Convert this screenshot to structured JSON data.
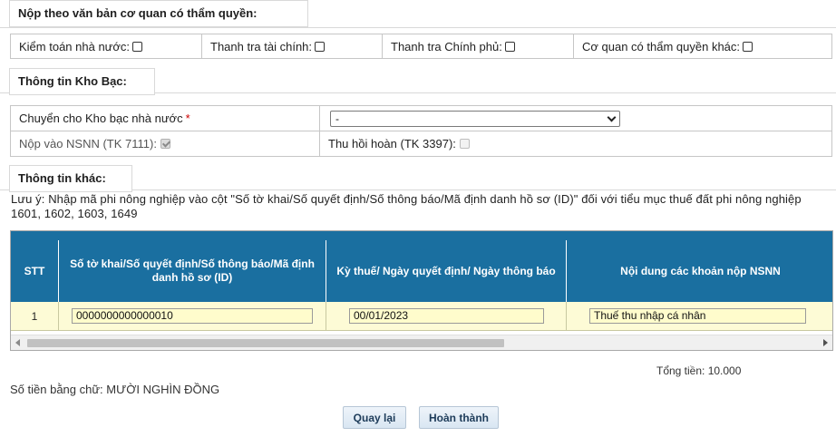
{
  "authority": {
    "header": "Nộp theo văn bản cơ quan có thẩm quyền:",
    "options": [
      {
        "label": "Kiểm toán nhà nước:",
        "checked": false
      },
      {
        "label": "Thanh tra tài chính:",
        "checked": false
      },
      {
        "label": "Thanh tra Chính phủ:",
        "checked": false
      },
      {
        "label": "Cơ quan có thẩm quyền khác:",
        "checked": false
      }
    ]
  },
  "treasury": {
    "header": "Thông tin Kho Bạc:",
    "transfer_label": "Chuyển cho Kho bạc nhà nước",
    "required_mark": "*",
    "transfer_value": "-",
    "nsnn_label": "Nộp vào NSNN (TK 7111):",
    "nsnn_checked": true,
    "refund_label": "Thu hồi hoàn (TK 3397):",
    "refund_checked": false
  },
  "other": {
    "header": "Thông tin khác:",
    "note": "Lưu ý: Nhập mã phi nông nghiệp vào cột \"Số tờ khai/Số quyết định/Số thông báo/Mã định danh hồ sơ (ID)\" đối với tiểu mục thuế đất phi nông nghiệp 1601, 1602, 1603, 1649"
  },
  "table": {
    "columns": [
      "STT",
      "Số tờ khai/Số quyết định/Số thông báo/Mã định danh hồ sơ (ID)",
      "Kỳ thuế/ Ngày quyết định/ Ngày thông báo",
      "Nội dung các khoản nộp NSNN"
    ],
    "rows": [
      {
        "stt": "1",
        "doc_id": "0000000000000010",
        "date": "00/01/2023",
        "content": "Thuế thu nhập cá nhân"
      }
    ],
    "header_color": "#1a6fa0",
    "row_color": "#fdfbd6"
  },
  "summary": {
    "total": "Tổng tiền: 10.000",
    "in_words": "Số tiền bằng chữ: MƯỜI NGHÌN ĐỒNG"
  },
  "buttons": {
    "back": "Quay lại",
    "finish": "Hoàn thành"
  },
  "icons": {
    "dropdown": "chevron-down-icon",
    "scroll_left": "arrow-left-icon",
    "scroll_right": "arrow-right-icon"
  }
}
